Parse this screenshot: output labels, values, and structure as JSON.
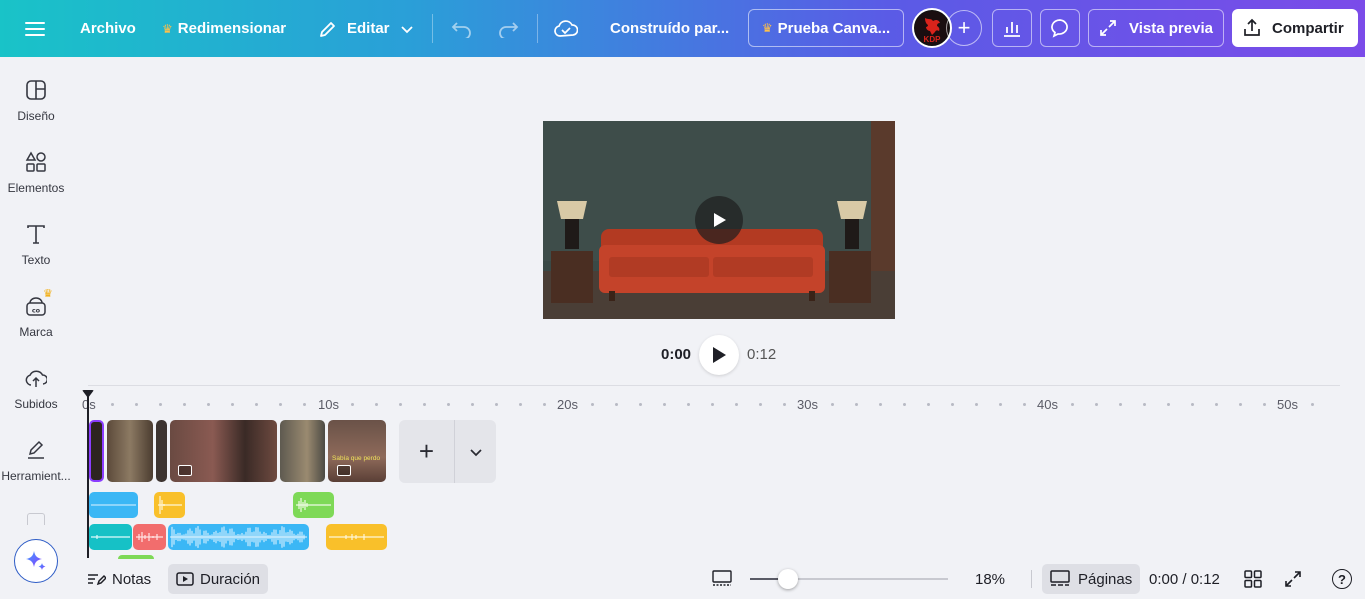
{
  "topbar": {
    "archivo": "Archivo",
    "redimensionar": "Redimensionar",
    "editar": "Editar",
    "design_title": "Construído par...",
    "trial": "Prueba Canva...",
    "avatar_text": "KDP",
    "preview": "Vista previa",
    "share": "Compartir"
  },
  "sidebar": {
    "items": [
      {
        "label": "Diseño",
        "icon": "layout-icon"
      },
      {
        "label": "Elementos",
        "icon": "shapes-icon"
      },
      {
        "label": "Texto",
        "icon": "text-icon"
      },
      {
        "label": "Marca",
        "icon": "brand-icon"
      },
      {
        "label": "Subidos",
        "icon": "cloud-upload-icon"
      },
      {
        "label": "Herramient...",
        "icon": "draw-tool-icon"
      }
    ]
  },
  "playback": {
    "current": "0:00",
    "total": "0:12"
  },
  "timeline": {
    "ticks": [
      "0s",
      "10s",
      "20s",
      "30s",
      "40s",
      "50s"
    ],
    "clip_caption": "Sabía que perdo",
    "add_page": "+"
  },
  "bottom": {
    "notes": "Notas",
    "duration": "Duración",
    "zoom": "18%",
    "zoom_level": 0.18,
    "pages": "Páginas",
    "time": "0:00 / 0:12",
    "help": "?"
  },
  "colors": {
    "gradient_start": "#19c3c8",
    "gradient_end": "#7b4be9",
    "audio_blue": "#3bb7f5",
    "audio_yellow": "#f9c02a",
    "audio_green": "#7ed957",
    "audio_teal": "#16c1c6",
    "audio_red": "#f26d6d",
    "selection": "#8b3dff"
  }
}
